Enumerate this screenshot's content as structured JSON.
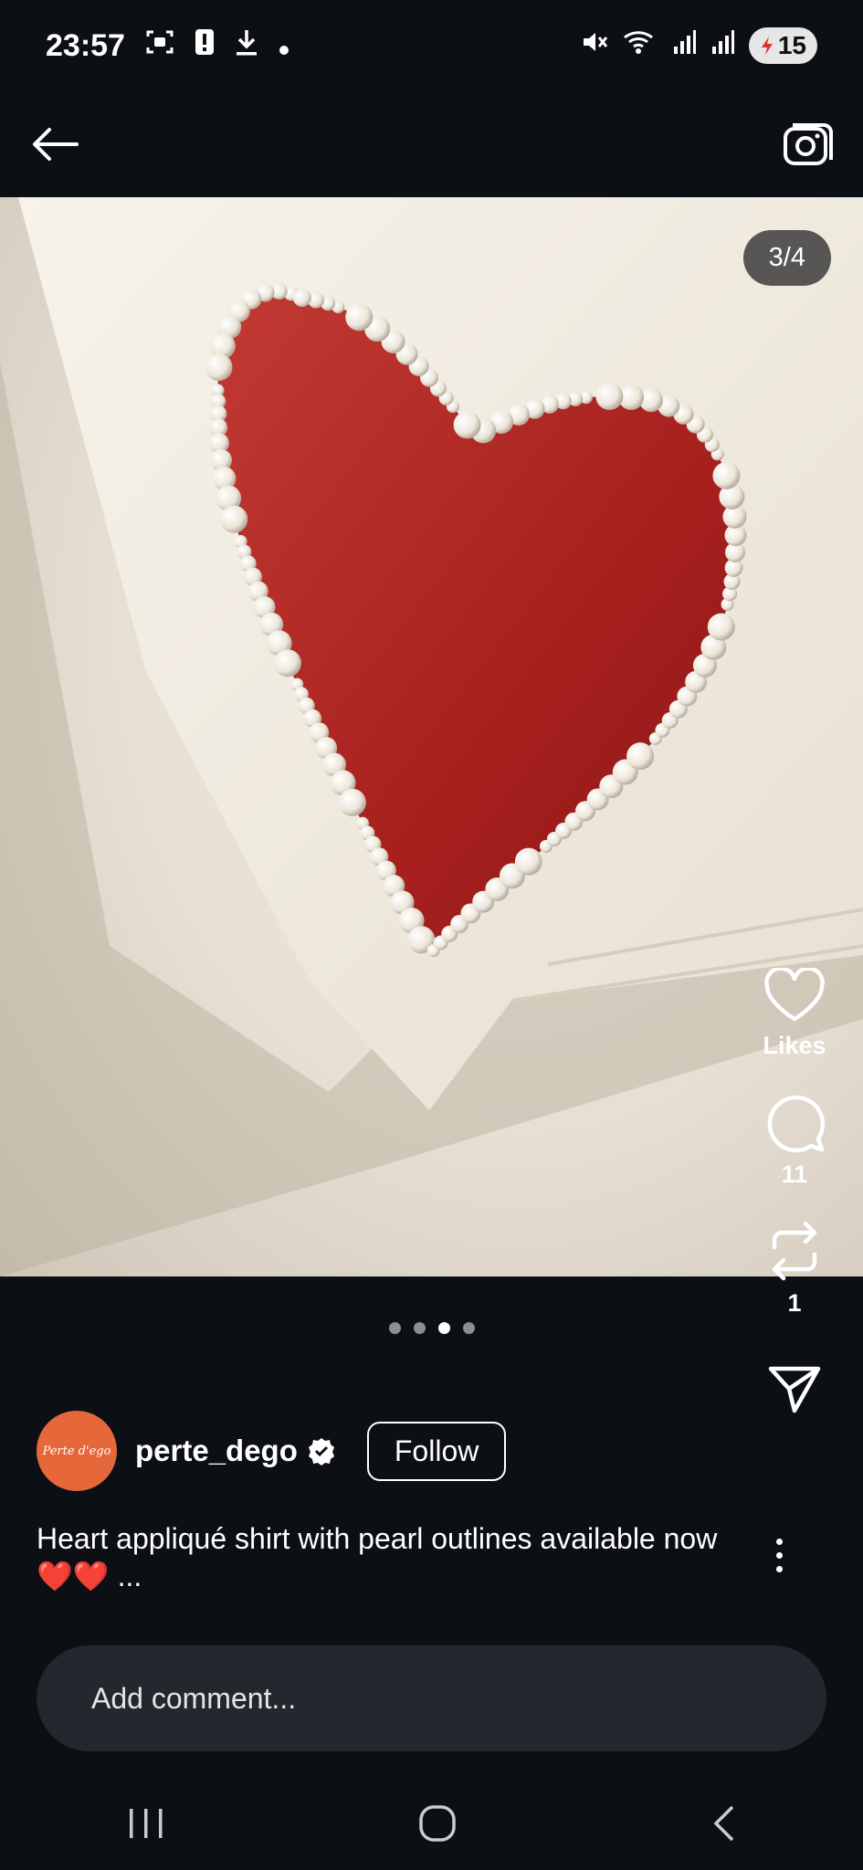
{
  "status": {
    "time": "23:57",
    "battery": "15"
  },
  "photo": {
    "counter": "3/4"
  },
  "actions": {
    "likes_label": "Likes",
    "comments_count": "11",
    "reposts_count": "1"
  },
  "carousel": {
    "total": 4,
    "active_index": 3
  },
  "post": {
    "username": "perte_dego",
    "avatar_text": "Perte d'ego",
    "follow_label": "Follow",
    "caption": "Heart appliqué shirt with pearl outlines available now ❤️❤️ ..."
  },
  "comment": {
    "placeholder": "Add comment..."
  },
  "colors": {
    "background": "#0c0f14",
    "avatar": "#e5673a",
    "heart_fabric": "#b0211f"
  }
}
